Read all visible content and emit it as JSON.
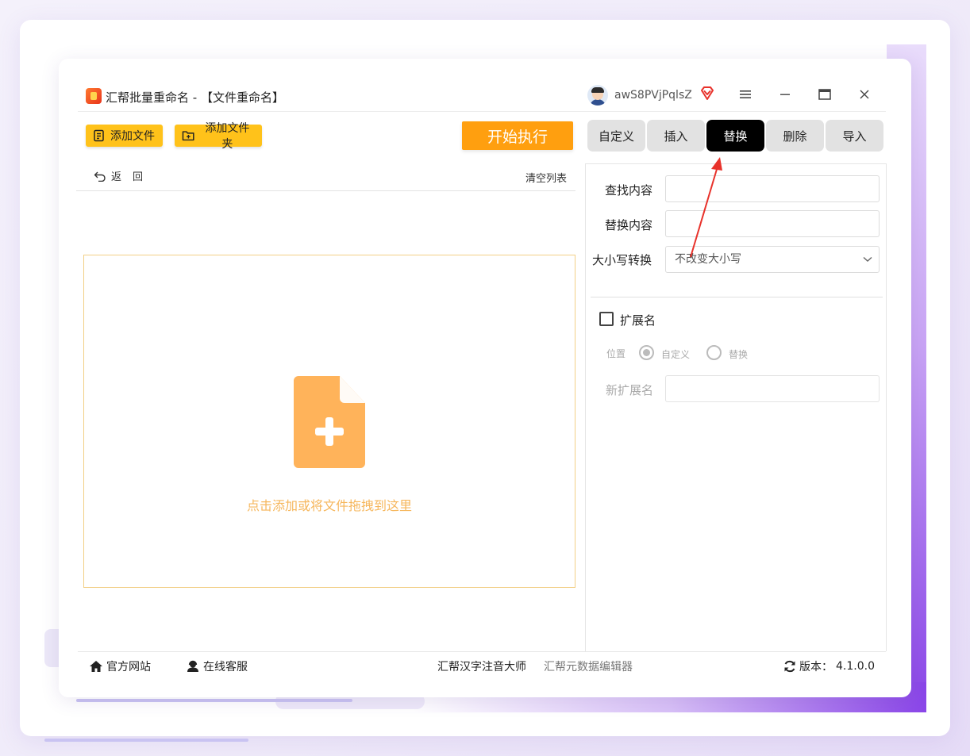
{
  "window": {
    "title": "汇帮批量重命名 - 【文件重命名】",
    "username": "awS8PVjPqlsZ"
  },
  "toolbar": {
    "add_file": "添加文件",
    "add_folder": "添加文件夹",
    "start": "开始执行"
  },
  "tabs": [
    {
      "label": "自定义",
      "active": false
    },
    {
      "label": "插入",
      "active": false
    },
    {
      "label": "替换",
      "active": true
    },
    {
      "label": "删除",
      "active": false
    },
    {
      "label": "导入",
      "active": false
    }
  ],
  "list": {
    "back": "返回",
    "clear": "清空列表",
    "drop_hint": "点击添加或将文件拖拽到这里"
  },
  "replace_panel": {
    "find_label": "查找内容",
    "find_value": "",
    "replace_label": "替换内容",
    "replace_value": "",
    "case_label": "大小写转换",
    "case_value": "不改变大小写",
    "extension_label": "扩展名",
    "extension_checked": false,
    "position_label": "位置",
    "position_options": [
      "自定义",
      "替换"
    ],
    "position_selected": "自定义",
    "new_ext_label": "新扩展名",
    "new_ext_value": ""
  },
  "footer": {
    "website": "官方网站",
    "support": "在线客服",
    "app1": "汇帮汉字注音大师",
    "app2": "汇帮元数据编辑器",
    "version_label": "版本：",
    "version": "4.1.0.0"
  },
  "colors": {
    "accent_yellow": "#ffc21a",
    "start_orange": "#ff9f0f",
    "active_tab": "#000000",
    "drop_border": "#f2cf86",
    "drop_icon": "#ffb35a",
    "arrow_red": "#e8322b"
  }
}
